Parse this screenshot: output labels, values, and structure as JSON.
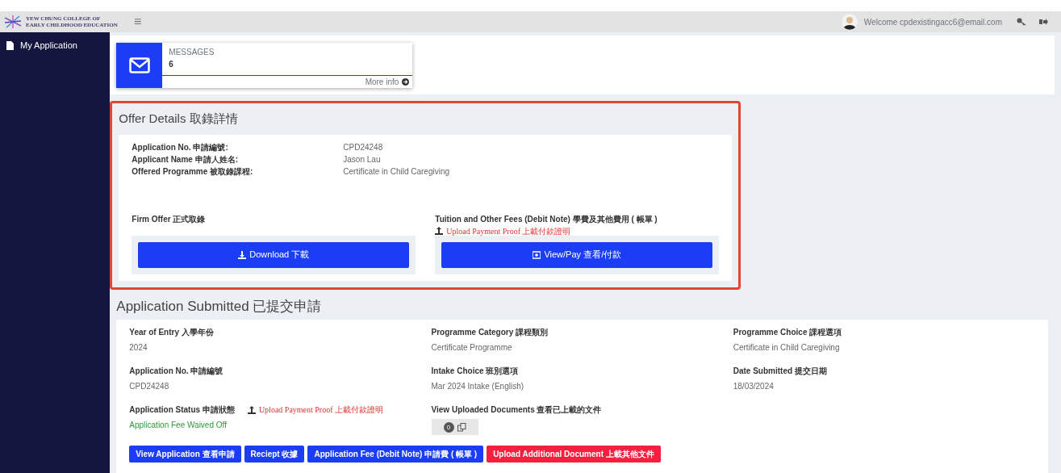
{
  "header": {
    "logo_lines": [
      "YEW CHUNG COLLEGE OF",
      "EARLY CHILDHOOD EDUCATION"
    ],
    "menu_glyph": "≡",
    "welcome": "Welcome cpdexistingacc6@email.com"
  },
  "sidebar": {
    "items": [
      {
        "label": "My Application"
      }
    ]
  },
  "messages": {
    "label": "MESSAGES",
    "count": "6",
    "link": "More info"
  },
  "offer": {
    "title": "Offer Details 取錄詳情",
    "highlighted": true,
    "fields": [
      {
        "label": "Application No. 申請編號:",
        "value": "CPD24248"
      },
      {
        "label": "Applicant Name 申請人姓名:",
        "value": "Jason Lau"
      },
      {
        "label": "Offered Programme 被取錄課程:",
        "value": "Certificate in Child Caregiving"
      }
    ],
    "firm_offer": {
      "label": "Firm Offer 正式取錄",
      "button": "Download 下載"
    },
    "fees": {
      "label": "Tuition and Other Fees (Debit Note) 學費及其他費用 ( 帳單 )",
      "upload_link": "Upload Payment Proof 上載付款證明",
      "button": "View/Pay 查看/付款"
    }
  },
  "application": {
    "title": "Application Submitted 已提交申請",
    "fields": [
      {
        "kind": "text",
        "label": "Year of Entry 入學年份",
        "value": "2024"
      },
      {
        "kind": "text",
        "label": "Programme Category 課程類別",
        "value": "Certificate Programme"
      },
      {
        "kind": "text",
        "label": "Programme Choice 課程選項",
        "value": "Certificate in Child Caregiving"
      },
      {
        "kind": "text",
        "label": "Application No. 申請編號",
        "value": "CPD24248"
      },
      {
        "kind": "text",
        "label": "Intake Choice 班別選項",
        "value": "Mar 2024 Intake (English)"
      },
      {
        "kind": "text",
        "label": "Date Submitted 提交日期",
        "value": "18/03/2024"
      },
      {
        "kind": "status",
        "label": "Application Status 申請狀態",
        "upload_link": "Upload Payment Proof 上載付款證明",
        "value": "Application Fee Waived Off"
      },
      {
        "kind": "documents",
        "label": "View Uploaded Documents 查看已上載的文件",
        "count": "0"
      }
    ],
    "buttons": [
      {
        "kind": "primary",
        "label": "View Application 查看申請"
      },
      {
        "kind": "primary",
        "label": "Reciept 收據"
      },
      {
        "kind": "primary",
        "label": "Application Fee (Debit Note) 申請費 ( 帳單 )"
      },
      {
        "kind": "danger",
        "label": "Upload Additional Document 上載其他文件"
      }
    ]
  }
}
